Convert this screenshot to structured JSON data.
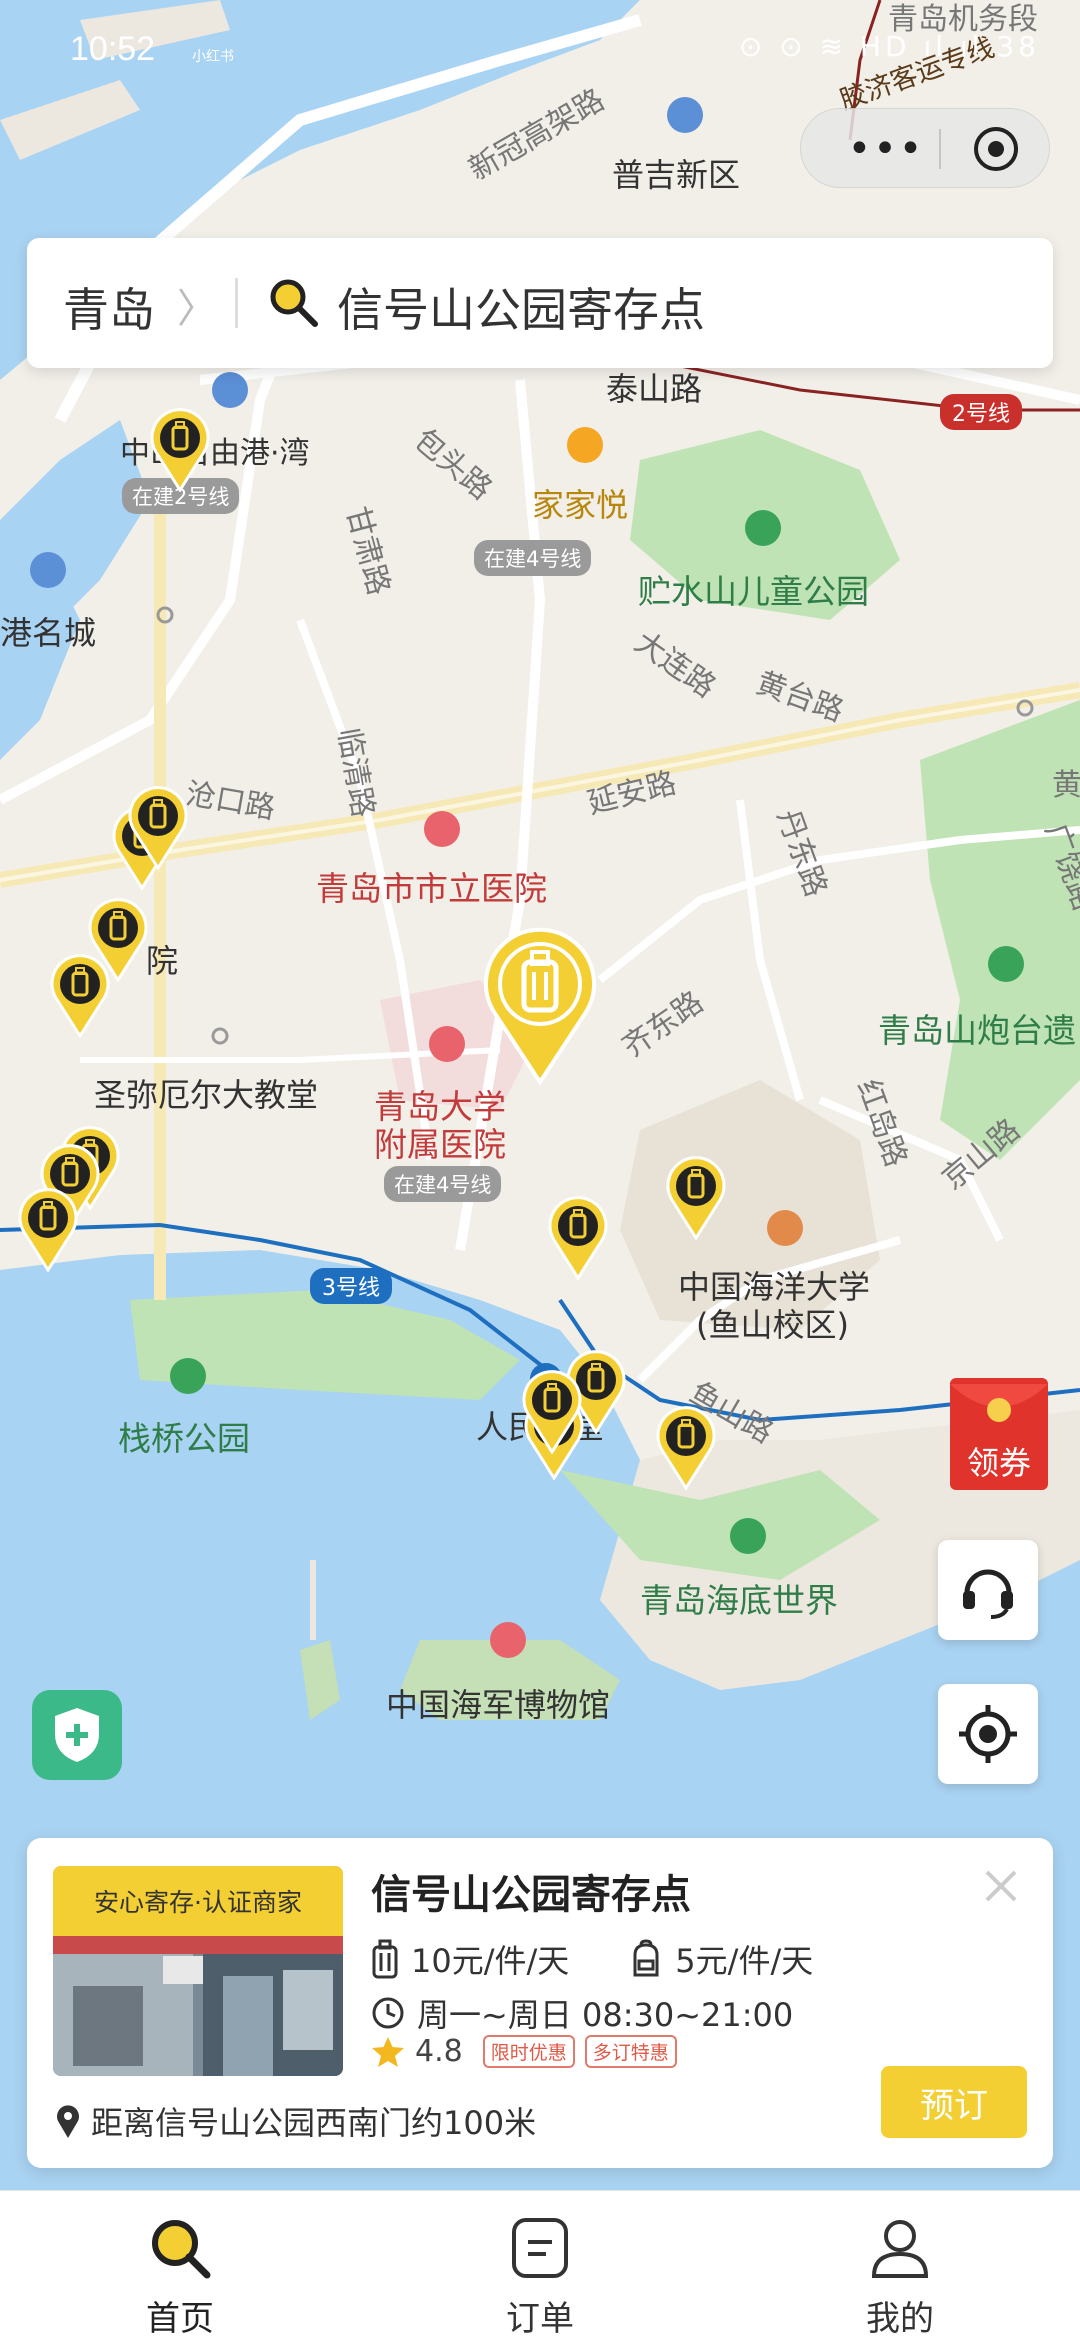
{
  "status_bar": {
    "time": "10:52",
    "carrier": "小红书",
    "right": "⊙ ⊙ ≋ HD ıl ıl 38"
  },
  "capsule": {
    "more": "•••"
  },
  "search": {
    "city": "青岛",
    "chevron": "〉",
    "query": "信号山公园寄存点"
  },
  "map": {
    "labels": {
      "qd_jiwuduan": "青岛机务段",
      "jiaoji": "胶济客运专线",
      "xinguan": "新冠高架路",
      "puji": "普吉新区",
      "taishan": "泰山路",
      "line2": "2号线",
      "zhongshan": "中山自由港·湾",
      "zaijian2": "在建2号线",
      "baotou": "包头路",
      "jiajiayue": "家家悦",
      "zaijian4a": "在建4号线",
      "ganlu": "甘肃路",
      "zhushui": "贮水山儿童公园",
      "gangcheng": "港名城",
      "dalian": "大连路",
      "huangtai": "黄台路",
      "cangkou": "沧口路",
      "linqing": "临清路",
      "yanan": "延安路",
      "shili": "青岛市市立医院",
      "dandong": "丹东路",
      "yuan": "院",
      "qidong": "齐东路",
      "paotai": "青岛山炮台遗",
      "shengmi": "圣弥厄尔大教堂",
      "fushu1": "青岛大学",
      "fushu2": "附属医院",
      "zaijian4b": "在建4号线",
      "hongdao": "红岛路",
      "jingshan": "京山路",
      "line3": "3号线",
      "haiyang1": "中国海洋大学",
      "haiyang2": "(鱼山校区)",
      "zhanqiao": "栈桥公园",
      "renmin": "人民会堂",
      "yushan": "鱼山路",
      "haidi": "青岛海底世界",
      "haijun": "中国海军博物馆",
      "guangrao": "广饶路",
      "huang": "黄"
    }
  },
  "coupon": {
    "label": "领券"
  },
  "card": {
    "badge": "安心寄存·认证商家",
    "title": "信号山公园寄存点",
    "price_luggage": "10元/件/天",
    "price_bag": "5元/件/天",
    "hours": "周一~周日 08:30~21:00",
    "rating": "4.8",
    "tag1": "限时优惠",
    "tag2": "多订特惠",
    "distance": "距离信号山公园西南门约100米",
    "book": "预订"
  },
  "tabs": [
    {
      "label": "首页"
    },
    {
      "label": "订单"
    },
    {
      "label": "我的"
    }
  ],
  "colors": {
    "accent": "#f3cf34",
    "water": "#a9d3f2",
    "green": "#bfe3b4",
    "map_bg": "#f2efe9"
  }
}
